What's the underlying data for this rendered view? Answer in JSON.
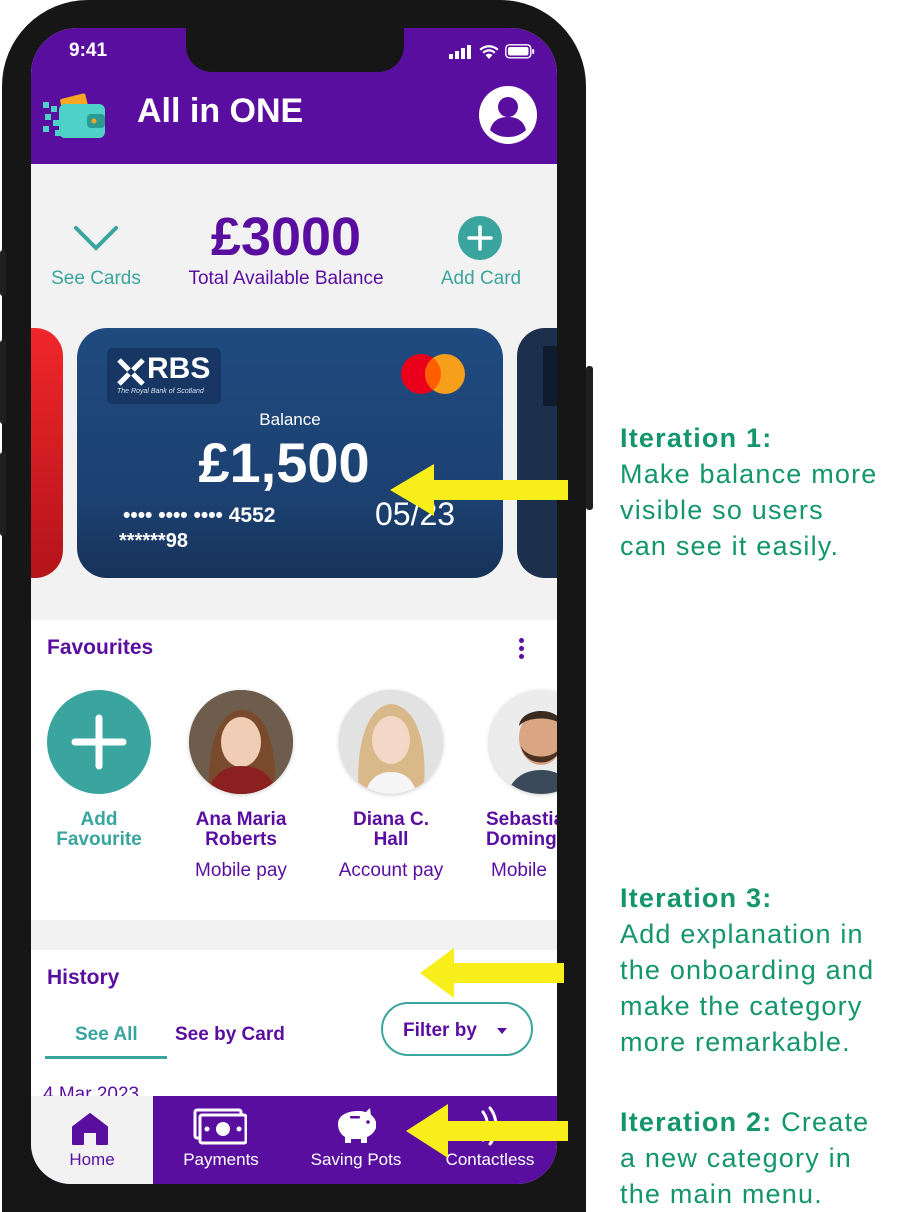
{
  "status": {
    "time": "9:41"
  },
  "header": {
    "app_title": "All in ONE"
  },
  "balance": {
    "see_cards_label": "See Cards",
    "total_amount": "£3000",
    "total_label": "Total Available Balance",
    "add_card_label": "Add Card"
  },
  "card": {
    "bank_name": "RBS",
    "bank_subtitle": "The Royal Bank of Scotland",
    "balance_label": "Balance",
    "balance_value": "£1,500",
    "card_number": "•••• •••• •••• 4552",
    "secondary_number": "******98",
    "expiry": "05/23"
  },
  "favourites": {
    "title": "Favourites",
    "items": [
      {
        "name_line1": "Add",
        "name_line2": "Favourite",
        "type": ""
      },
      {
        "name_line1": "Ana Maria",
        "name_line2": "Roberts",
        "type": "Mobile pay"
      },
      {
        "name_line1": "Diana C.",
        "name_line2": "Hall",
        "type": "Account pay"
      },
      {
        "name_line1": "Sebastia",
        "name_line2": "Doming",
        "type": "Mobile"
      }
    ]
  },
  "history": {
    "title": "History",
    "tab_all": "See All",
    "tab_by_card": "See by Card",
    "filter_label": "Filter by",
    "first_date": "4 Mar 2023"
  },
  "nav": {
    "home": "Home",
    "payments": "Payments",
    "saving_pots": "Saving Pots",
    "contactless": "Contactless"
  },
  "annotations": {
    "iteration1_title": "Iteration 1:",
    "iteration1_line1": "Make balance more",
    "iteration1_line2": "visible so users",
    "iteration1_line3": "can see it easily.",
    "iteration3_title": "Iteration 3:",
    "iteration3_line1": "Add explanation in",
    "iteration3_line2": "the onboarding and",
    "iteration3_line3": "make the category",
    "iteration3_line4": "more remarkable.",
    "iteration2_title": "Iteration 2:",
    "iteration2_line1_rest": "Create",
    "iteration2_line2": "a new category in",
    "iteration2_line3": "the main menu."
  },
  "colors": {
    "brand_purple": "#5a0ea0",
    "accent_teal": "#3aa59e",
    "annotation_green": "#13966c",
    "arrow_yellow": "#f7ee1c",
    "card_blue": "#1f4b80"
  }
}
